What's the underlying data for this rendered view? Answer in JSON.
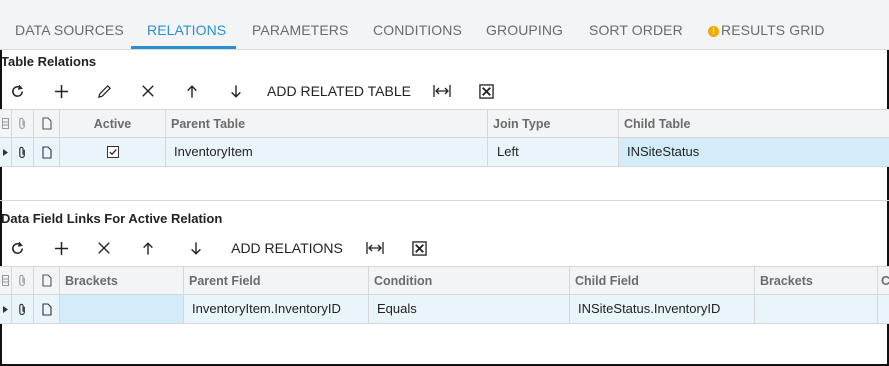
{
  "tabs": [
    {
      "label": "DATA SOURCES"
    },
    {
      "label": "RELATIONS"
    },
    {
      "label": "PARAMETERS"
    },
    {
      "label": "CONDITIONS"
    },
    {
      "label": "GROUPING"
    },
    {
      "label": "SORT ORDER"
    },
    {
      "label": "RESULTS GRID",
      "icon": "warning-icon",
      "icon_glyph": "!"
    }
  ],
  "active_tab": "RELATIONS",
  "colors": {
    "accent": "#2a8fd0",
    "warning": "#f2a900",
    "row_selected": "#eaf5fb"
  },
  "table_relations": {
    "title": "Table Relations",
    "toolbar": {
      "add_related_table_label": "ADD RELATED TABLE"
    },
    "columns": {
      "active": "Active",
      "parent_table": "Parent Table",
      "join_type": "Join Type",
      "child_table": "Child Table"
    },
    "rows": [
      {
        "active": true,
        "parent_table": "InventoryItem",
        "join_type": "Left",
        "child_table": "INSiteStatus"
      }
    ]
  },
  "data_field_links": {
    "title": "Data Field Links For Active Relation",
    "toolbar": {
      "add_relations_label": "ADD RELATIONS"
    },
    "columns": {
      "brackets_open": "Brackets",
      "parent_field": "Parent Field",
      "condition": "Condition",
      "child_field": "Child Field",
      "brackets_close": "Brackets",
      "overflow": "C"
    },
    "rows": [
      {
        "brackets_open": "",
        "parent_field": "InventoryItem.InventoryID",
        "condition": "Equals",
        "child_field": "INSiteStatus.InventoryID",
        "brackets_close": ""
      }
    ]
  }
}
